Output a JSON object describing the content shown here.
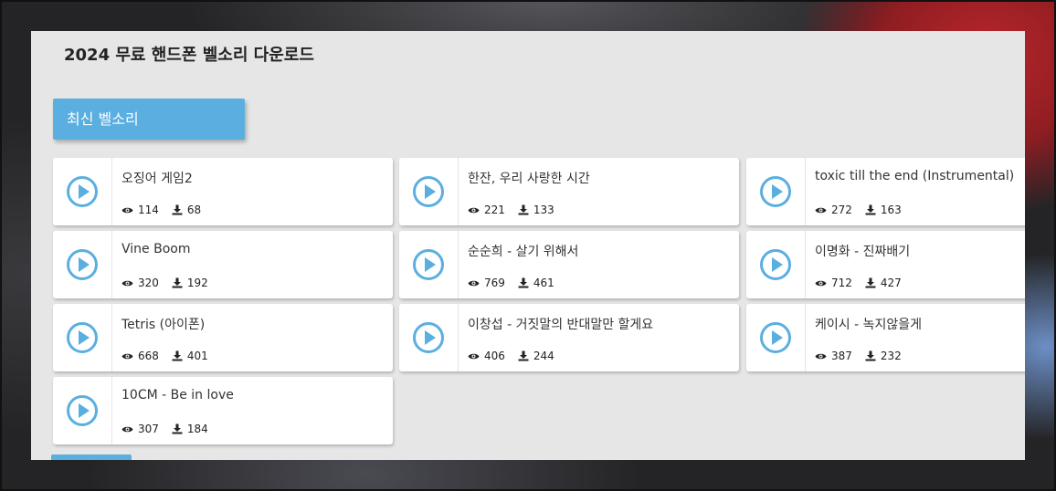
{
  "page": {
    "title": "2024 무료 핸드폰 벨소리 다운로드"
  },
  "section": {
    "tab_label": "최신 벨소리"
  },
  "colors": {
    "accent": "#5aafe0",
    "panel": "#e6e6e6",
    "card": "#ffffff",
    "play_icon": "#5aafe0"
  },
  "icons": {
    "play": "play-circle-icon",
    "views": "eye-icon",
    "downloads": "download-icon"
  },
  "ringtones": [
    {
      "title": "오징어 게임2",
      "views": "114",
      "downloads": "68"
    },
    {
      "title": "한잔, 우리 사랑한 시간",
      "views": "221",
      "downloads": "133"
    },
    {
      "title": "toxic till the end (Instrumental)",
      "views": "272",
      "downloads": "163"
    },
    {
      "title": "Vine Boom",
      "views": "320",
      "downloads": "192"
    },
    {
      "title": "순순희 - 살기 위해서",
      "views": "769",
      "downloads": "461"
    },
    {
      "title": "이명화 - 진짜배기",
      "views": "712",
      "downloads": "427"
    },
    {
      "title": "Tetris (아이폰)",
      "views": "668",
      "downloads": "401"
    },
    {
      "title": "이창섭 - 거짓말의 반대말만 할게요",
      "views": "406",
      "downloads": "244"
    },
    {
      "title": "케이시 - 녹지않을게",
      "views": "387",
      "downloads": "232"
    },
    {
      "title": "10CM - Be in love",
      "views": "307",
      "downloads": "184"
    }
  ]
}
